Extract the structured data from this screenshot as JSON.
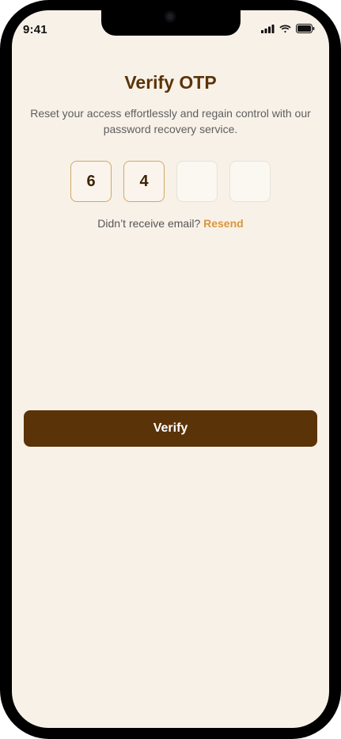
{
  "status_bar": {
    "time": "9:41",
    "icons": [
      "signal-icon",
      "wifi-icon",
      "battery-icon"
    ]
  },
  "header": {
    "title": "Verify OTP",
    "subtitle": "Reset your access effortlessly and regain control with our password recovery service."
  },
  "otp": {
    "digits": [
      "6",
      "4",
      "",
      ""
    ]
  },
  "resend": {
    "prompt": "Didn’t receive email?",
    "link_label": "Resend"
  },
  "actions": {
    "verify_label": "Verify"
  },
  "colors": {
    "background": "#f8f1e8",
    "title": "#5a3409",
    "accent": "#d9963e",
    "primary_button": "#5b3308",
    "filled_border": "#cfa868",
    "empty_border": "#e8e1d7"
  }
}
